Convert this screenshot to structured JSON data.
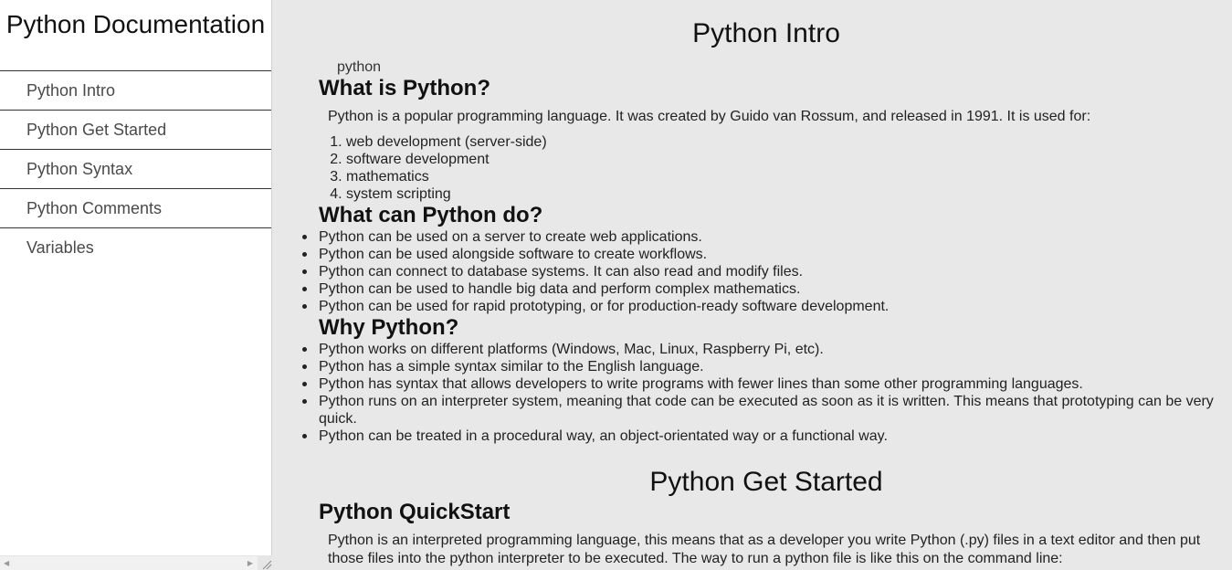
{
  "sidebar": {
    "title": "Python Documentation",
    "items": [
      {
        "label": "Python Intro"
      },
      {
        "label": "Python Get Started"
      },
      {
        "label": "Python Syntax"
      },
      {
        "label": "Python Comments"
      },
      {
        "label": "Variables"
      }
    ]
  },
  "main": {
    "intro": {
      "header": "Python Intro",
      "image_alt": "python",
      "what_title": "What is Python?",
      "what_text": "Python is a popular programming language. It was created by Guido van Rossum, and released in 1991. It is used for:",
      "uses": [
        "web development (server-side)",
        "software development",
        "mathematics",
        "system scripting"
      ],
      "can_do_title": "What can Python do?",
      "can_do": [
        "Python can be used on a server to create web applications.",
        "Python can be used alongside software to create workflows.",
        "Python can connect to database systems. It can also read and modify files.",
        "Python can be used to handle big data and perform complex mathematics.",
        "Python can be used for rapid prototyping, or for production-ready software development."
      ],
      "why_title": "Why Python?",
      "why": [
        "Python works on different platforms (Windows, Mac, Linux, Raspberry Pi, etc).",
        "Python has a simple syntax similar to the English language.",
        "Python has syntax that allows developers to write programs with fewer lines than some other programming languages.",
        "Python runs on an interpreter system, meaning that code can be executed as soon as it is written. This means that prototyping can be very quick.",
        "Python can be treated in a procedural way, an object-orientated way or a functional way."
      ]
    },
    "get_started": {
      "header": "Python Get Started",
      "quickstart_title": "Python QuickStart",
      "quickstart_text": "Python is an interpreted programming language, this means that as a developer you write Python (.py) files in a text editor and then put those files into the python interpreter to be executed. The way to run a python file is like this on the command line:"
    }
  },
  "icons": {
    "scroll_left": "caret-left-icon",
    "scroll_right": "caret-right-icon",
    "resize": "resize-grip-icon"
  }
}
